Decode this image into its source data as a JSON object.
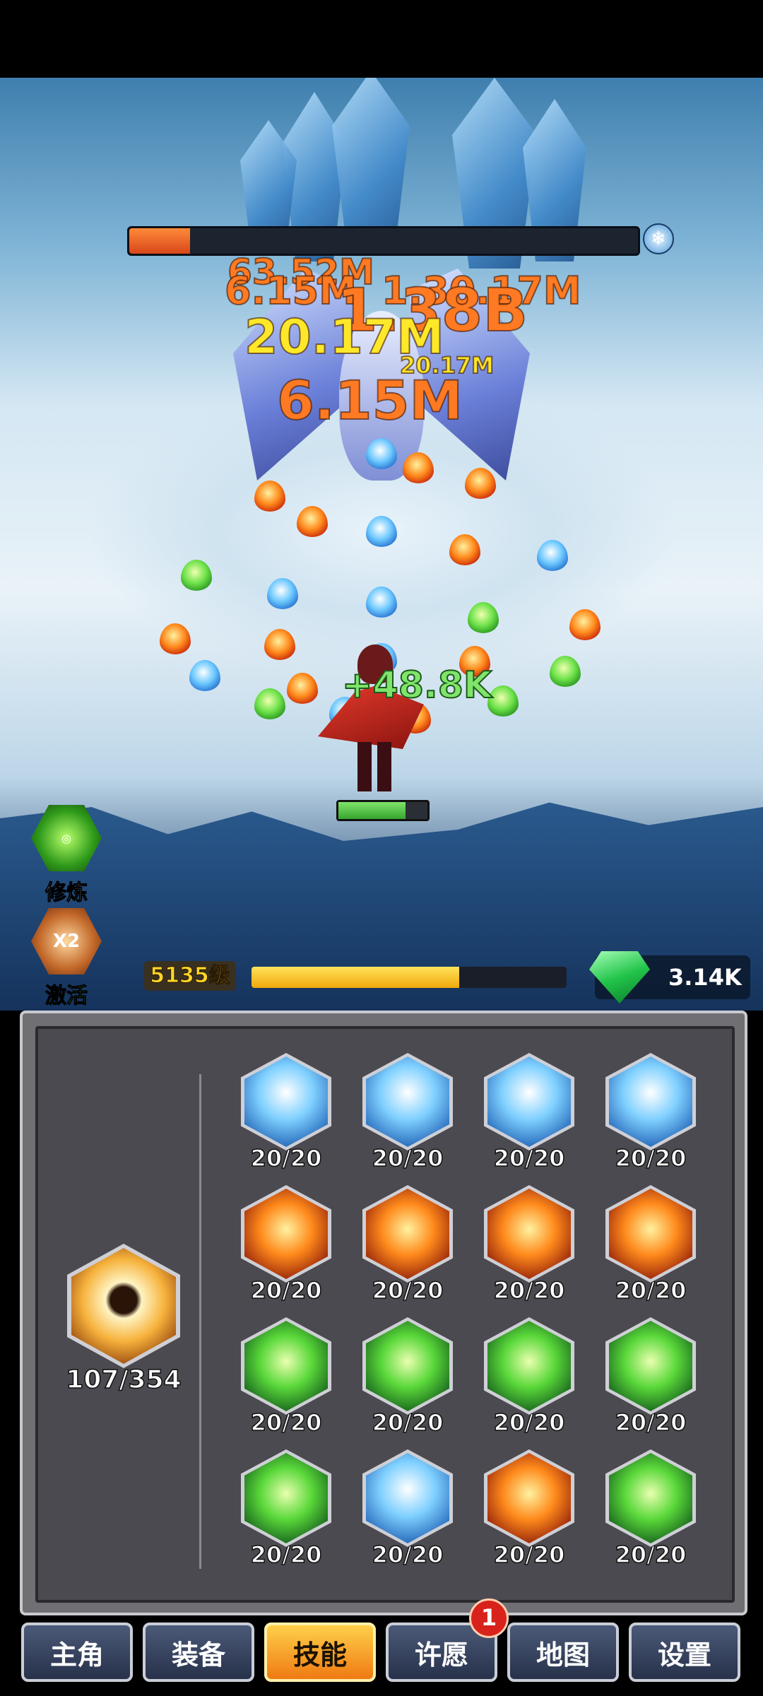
{
  "boss": {
    "hp_fraction": 0.12
  },
  "damage_numbers": [
    "63.52M",
    "6.15M",
    "20.17M",
    "1.30.17M",
    "20.17M",
    "20.17M",
    "6.15M",
    "1.38B"
  ],
  "hero": {
    "heal_text": "+48.8K",
    "hp_fraction": 0.75
  },
  "side_buttons": {
    "cultivate_label": "修炼",
    "activate_label": "激活",
    "activate_badge": "X2"
  },
  "level": {
    "label": "5135级",
    "exp_fraction": 0.66
  },
  "currency": {
    "gems": "3.14K"
  },
  "main_skill": {
    "count": "107/354"
  },
  "skills": [
    {
      "level": "20/20",
      "theme": "ice"
    },
    {
      "level": "20/20",
      "theme": "ice"
    },
    {
      "level": "20/20",
      "theme": "ice"
    },
    {
      "level": "20/20",
      "theme": "ice"
    },
    {
      "level": "20/20",
      "theme": "fire"
    },
    {
      "level": "20/20",
      "theme": "fire"
    },
    {
      "level": "20/20",
      "theme": "fire"
    },
    {
      "level": "20/20",
      "theme": "fire"
    },
    {
      "level": "20/20",
      "theme": "wind"
    },
    {
      "level": "20/20",
      "theme": "wind"
    },
    {
      "level": "20/20",
      "theme": "wind"
    },
    {
      "level": "20/20",
      "theme": "wind"
    },
    {
      "level": "20/20",
      "theme": "wind"
    },
    {
      "level": "20/20",
      "theme": "ice"
    },
    {
      "level": "20/20",
      "theme": "fire"
    },
    {
      "level": "20/20",
      "theme": "wind"
    }
  ],
  "nav": {
    "tabs": [
      {
        "label": "主角",
        "active": false
      },
      {
        "label": "装备",
        "active": false
      },
      {
        "label": "技能",
        "active": true
      },
      {
        "label": "许愿",
        "active": false
      },
      {
        "label": "地图",
        "active": false
      },
      {
        "label": "设置",
        "active": false
      }
    ],
    "wish_badge": "1"
  },
  "colors": {
    "active_tab": "#f6a624",
    "hp_boss": "#e35a22",
    "exp": "#f6c21c",
    "gem": "#22c44a"
  }
}
